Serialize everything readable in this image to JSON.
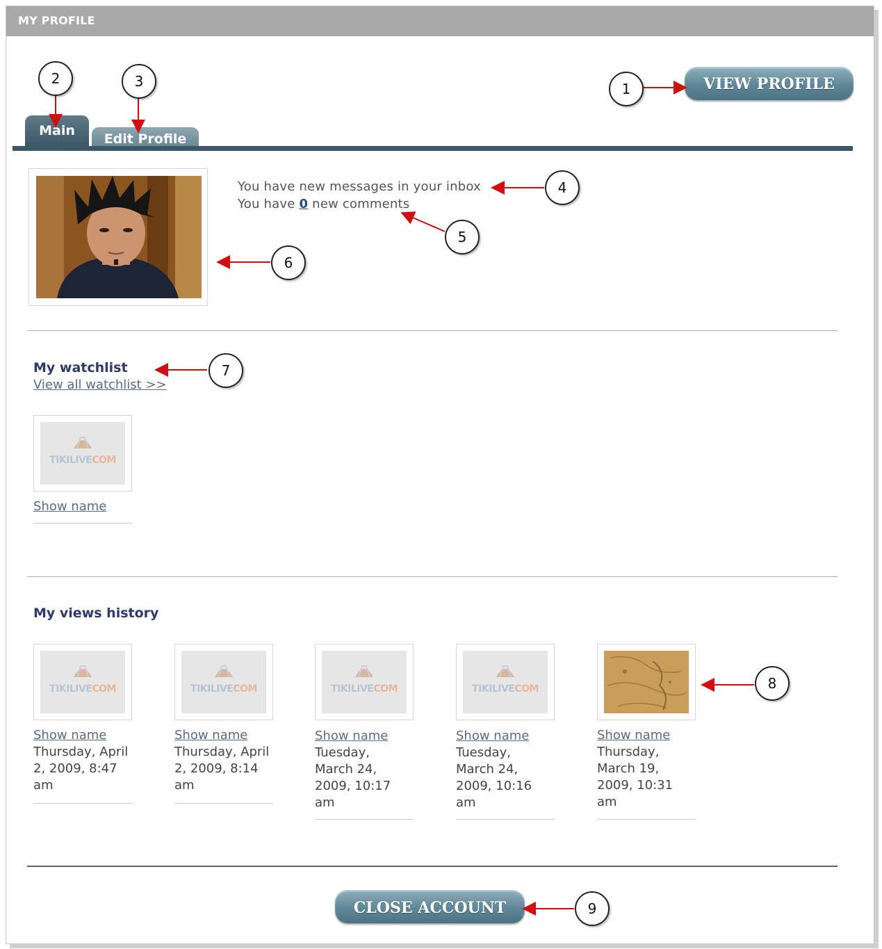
{
  "window": {
    "title": "MY PROFILE"
  },
  "buttons": {
    "view_profile": "VIEW PROFILE",
    "close_account": "CLOSE ACCOUNT"
  },
  "tabs": [
    {
      "label": "Main",
      "active": true
    },
    {
      "label": "Edit Profile",
      "active": false
    }
  ],
  "notifications": {
    "messages": "You have new messages in your inbox",
    "comments_prefix": "You have",
    "comments_count": "0",
    "comments_suffix": "new comments"
  },
  "watchlist": {
    "title": "My watchlist",
    "view_all": "View all watchlist >>",
    "items": [
      {
        "name": "Show name",
        "image": "tikilive-placeholder"
      }
    ]
  },
  "history": {
    "title": "My views history",
    "items": [
      {
        "name": "Show name",
        "lines": [
          "Thursday, April",
          "2, 2009, 8:47",
          "am"
        ],
        "image": "tikilive-placeholder"
      },
      {
        "name": "Show name",
        "lines": [
          "Thursday, April",
          "2, 2009, 8:14",
          "am"
        ],
        "image": "tikilive-placeholder"
      },
      {
        "name": "Show name",
        "lines": [
          "Tuesday,",
          "March 24,",
          "2009, 10:17",
          "am"
        ],
        "image": "tikilive-placeholder"
      },
      {
        "name": "Show name",
        "lines": [
          "Tuesday,",
          "March 24,",
          "2009, 10:16",
          "am"
        ],
        "image": "tikilive-placeholder"
      },
      {
        "name": "Show name",
        "lines": [
          "Thursday,",
          "March 19,",
          "2009, 10:31",
          "am"
        ],
        "image": "old-map"
      }
    ]
  },
  "placeholder_brand": {
    "left": "TIKILIVE",
    "right": "COM"
  },
  "callouts": [
    "1",
    "2",
    "3",
    "4",
    "5",
    "6",
    "7",
    "8",
    "9"
  ],
  "colors": {
    "accent": "#3c5868",
    "button": "#5f8797",
    "annotation_arrow": "#d01010",
    "title_bar": "#a9a9a9"
  }
}
